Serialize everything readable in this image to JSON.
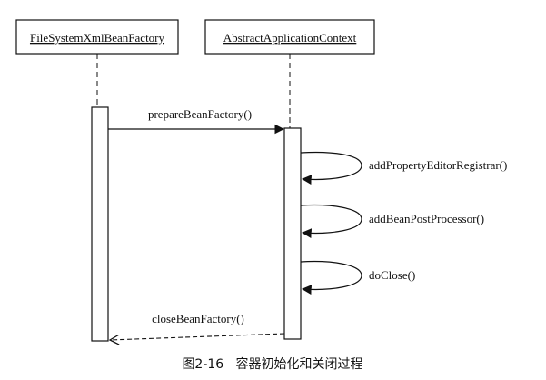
{
  "diagram": {
    "participants": [
      {
        "name": "FileSystemXmlBeanFactory"
      },
      {
        "name": "AbstractApplicationContext"
      }
    ],
    "messages": [
      {
        "label": "prepareBeanFactory()",
        "from": "FileSystemXmlBeanFactory",
        "to": "AbstractApplicationContext",
        "kind": "call"
      },
      {
        "label": "addPropertyEditorRegistrar()",
        "from": "AbstractApplicationContext",
        "to": "AbstractApplicationContext",
        "kind": "self"
      },
      {
        "label": "addBeanPostProcessor()",
        "from": "AbstractApplicationContext",
        "to": "AbstractApplicationContext",
        "kind": "self"
      },
      {
        "label": "doClose()",
        "from": "AbstractApplicationContext",
        "to": "AbstractApplicationContext",
        "kind": "self"
      },
      {
        "label": "closeBeanFactory()",
        "from": "AbstractApplicationContext",
        "to": "FileSystemXmlBeanFactory",
        "kind": "return"
      }
    ],
    "caption": "图2-16   容器初始化和关闭过程"
  }
}
